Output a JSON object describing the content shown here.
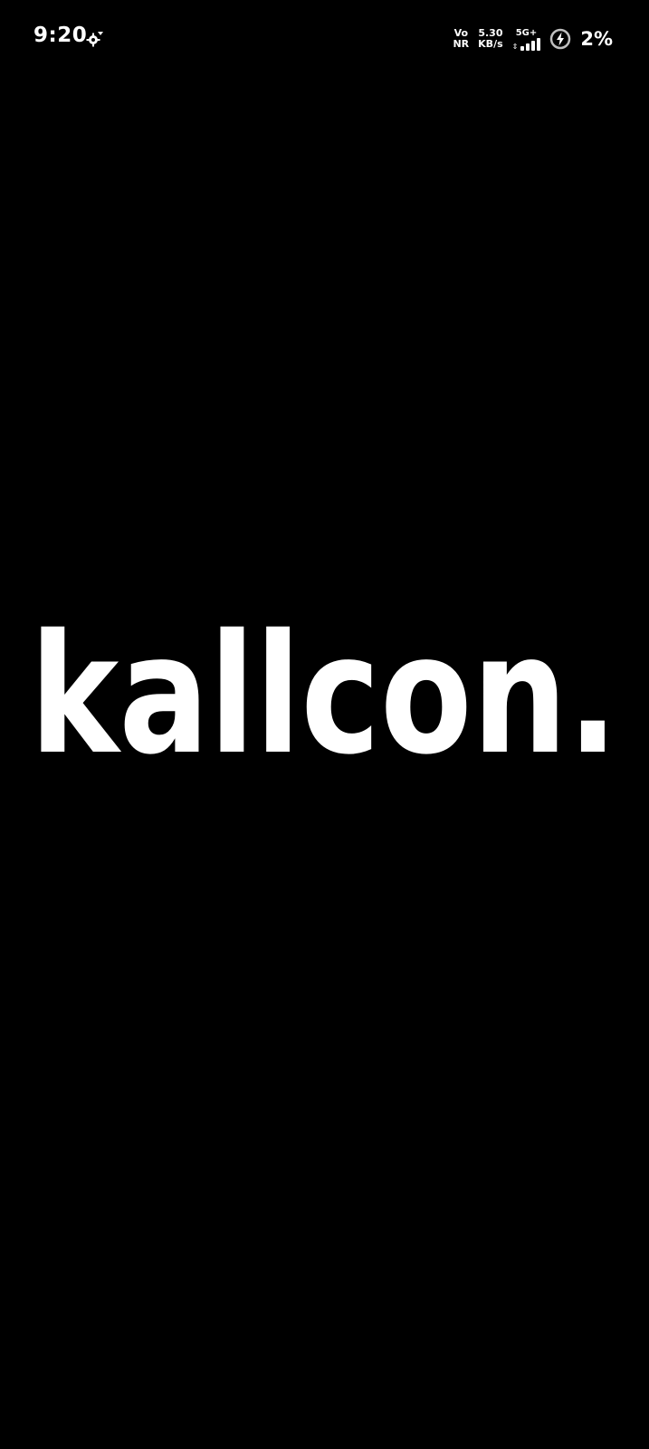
{
  "status_bar": {
    "time": "9:20",
    "volte_top": "Vo",
    "volte_bottom": "NR",
    "speed_value": "5.30",
    "speed_unit": "KB/s",
    "network_type": "5G+",
    "battery_percent": "2%",
    "icons": {
      "settings": "gear-icon",
      "signal": "signal-bars-icon",
      "battery": "battery-charging-icon"
    }
  },
  "splash": {
    "wordmark": "kallcon."
  },
  "colors": {
    "background": "#000000",
    "foreground": "#ffffff"
  }
}
